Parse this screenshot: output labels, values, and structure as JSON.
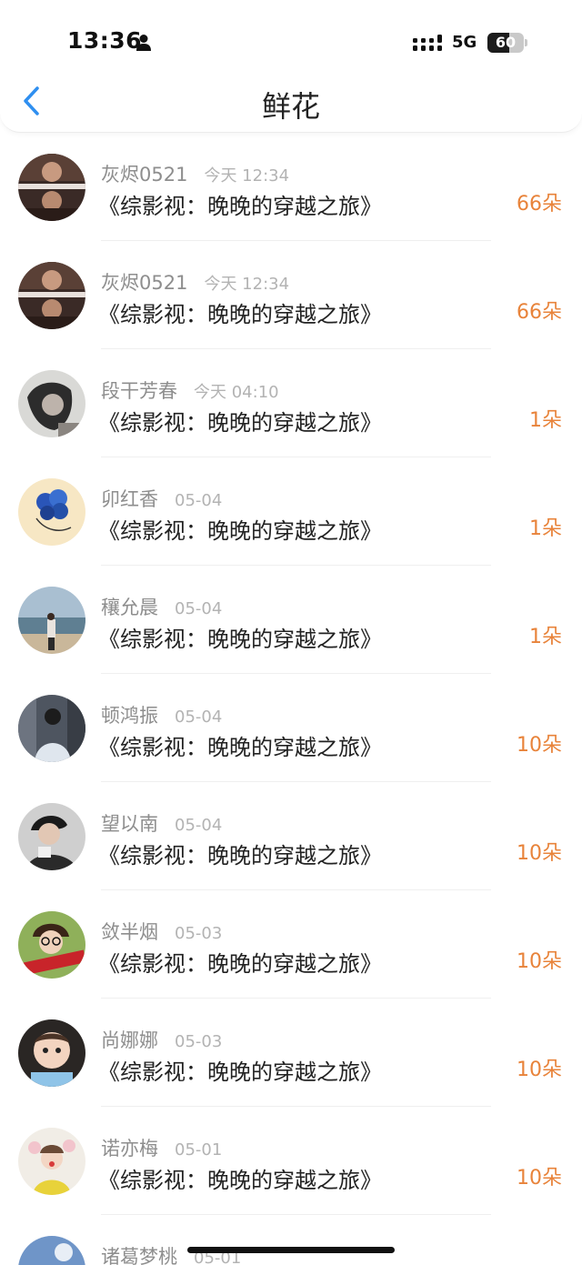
{
  "status_bar": {
    "time": "13:36",
    "network": "5G",
    "battery": "60",
    "battery_level": 0.6
  },
  "nav": {
    "title": "鲜花"
  },
  "colors": {
    "accent": "#e8833a",
    "back_arrow": "#2f8ff0"
  },
  "items": [
    {
      "name": "灰烬0521",
      "date": "今天 12:34",
      "book": "《综影视：晚晚的穿越之旅》",
      "count": "66朵"
    },
    {
      "name": "灰烬0521",
      "date": "今天 12:34",
      "book": "《综影视：晚晚的穿越之旅》",
      "count": "66朵"
    },
    {
      "name": "段干芳春",
      "date": "今天 04:10",
      "book": "《综影视：晚晚的穿越之旅》",
      "count": "1朵"
    },
    {
      "name": "卯红香",
      "date": "05-04",
      "book": "《综影视：晚晚的穿越之旅》",
      "count": "1朵"
    },
    {
      "name": "穰允晨",
      "date": "05-04",
      "book": "《综影视：晚晚的穿越之旅》",
      "count": "1朵"
    },
    {
      "name": "顿鸿振",
      "date": "05-04",
      "book": "《综影视：晚晚的穿越之旅》",
      "count": "10朵"
    },
    {
      "name": "望以南",
      "date": "05-04",
      "book": "《综影视：晚晚的穿越之旅》",
      "count": "10朵"
    },
    {
      "name": "敛半烟",
      "date": "05-03",
      "book": "《综影视：晚晚的穿越之旅》",
      "count": "10朵"
    },
    {
      "name": "尚娜娜",
      "date": "05-03",
      "book": "《综影视：晚晚的穿越之旅》",
      "count": "10朵"
    },
    {
      "name": "诺亦梅",
      "date": "05-01",
      "book": "《综影视：晚晚的穿越之旅》",
      "count": "10朵"
    },
    {
      "name": "诸葛梦桃",
      "date": "05-01",
      "book": "",
      "count": ""
    }
  ]
}
